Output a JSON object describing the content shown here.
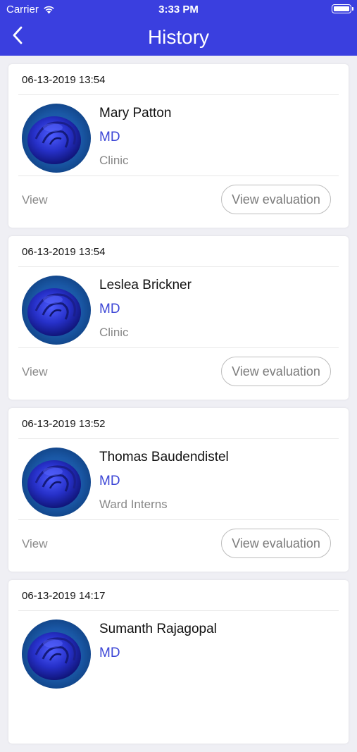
{
  "status_bar": {
    "carrier": "Carrier",
    "time": "3:33 PM"
  },
  "header": {
    "title": "History"
  },
  "colors": {
    "accent": "#3a3fdf",
    "role": "#3c46d6"
  },
  "labels": {
    "view": "View",
    "view_evaluation": "View evaluation"
  },
  "records": [
    {
      "date": "06-13-2019 13:54",
      "name": "Mary Patton",
      "role": "MD",
      "location": "Clinic"
    },
    {
      "date": "06-13-2019 13:54",
      "name": "Leslea Brickner",
      "role": "MD",
      "location": "Clinic"
    },
    {
      "date": "06-13-2019 13:52",
      "name": "Thomas Baudendistel",
      "role": "MD",
      "location": "Ward Interns"
    },
    {
      "date": "06-13-2019 14:17",
      "name": "Sumanth Rajagopal",
      "role": "MD",
      "location": ""
    }
  ]
}
